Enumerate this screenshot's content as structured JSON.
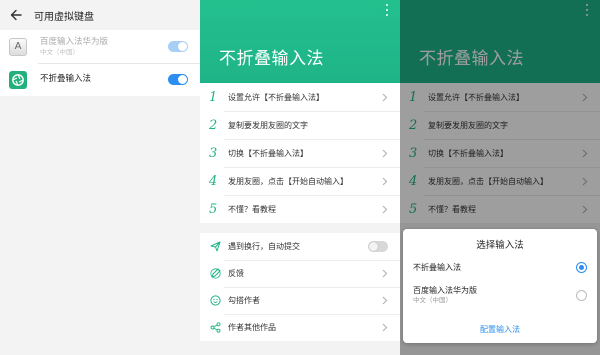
{
  "keyboard_settings": {
    "title": "可用虚拟键盘",
    "items": [
      {
        "name": "百度输入法华为版",
        "sub": "中文（中国）",
        "icon_letter": "A",
        "enabled": true,
        "disabled": true
      },
      {
        "name": "不折叠输入法",
        "sub": "",
        "enabled": true,
        "disabled": false
      }
    ]
  },
  "app": {
    "title": "不折叠输入法",
    "header_color": "#1fb487",
    "header_color_dimmed": "#177a5c",
    "steps": [
      {
        "num": "1",
        "text": "设置允许【不折叠输入法】"
      },
      {
        "num": "2",
        "text": "复制要发朋友圈的文字"
      },
      {
        "num": "3",
        "text": "切换【不折叠输入法】"
      },
      {
        "num": "4",
        "text": "发朋友圈，点击【开始自动输入】"
      },
      {
        "num": "5",
        "text": "不懂？看教程"
      }
    ],
    "options": [
      {
        "icon": "send-icon",
        "text": "遇到换行，自动提交",
        "toggle": false
      },
      {
        "icon": "feedback-icon",
        "text": "反馈"
      },
      {
        "icon": "author-icon",
        "text": "勾搭作者"
      },
      {
        "icon": "share-icon",
        "text": "作者其他作品"
      }
    ]
  },
  "dialog": {
    "title": "选择输入法",
    "items": [
      {
        "name": "不折叠输入法",
        "sub": "",
        "selected": true
      },
      {
        "name": "百度输入法华为版",
        "sub": "中文（中国）",
        "selected": false
      }
    ],
    "action": "配置输入法"
  },
  "colors": {
    "accent": "#1fb487",
    "blue": "#2b8ef0"
  }
}
